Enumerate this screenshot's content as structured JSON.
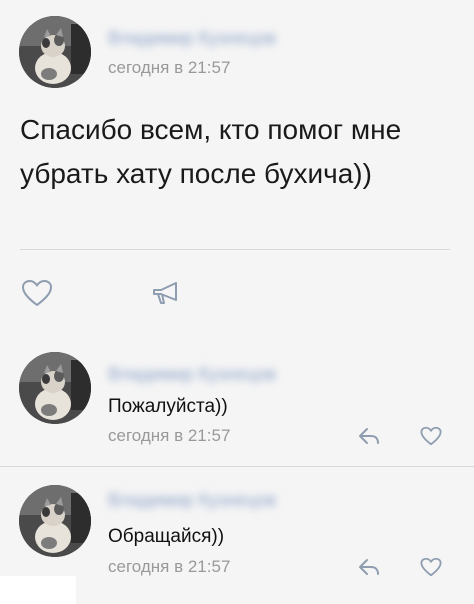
{
  "post": {
    "author_name": "Владимир Кузнецов",
    "timestamp": "сегодня в 21:57",
    "text": "Спасибо всем, кто помог мне убрать хату после бухича))",
    "actions": {
      "like_icon": "heart-icon",
      "share_icon": "megaphone-icon"
    }
  },
  "comments": [
    {
      "author_name": "Владимир Кузнецов",
      "text": "Пожалуйста))",
      "timestamp": "сегодня в 21:57",
      "reply_icon": "reply-icon",
      "like_icon": "heart-icon"
    },
    {
      "author_name": "Владимир Кузнецов",
      "text": "Обращайся))",
      "timestamp": "сегодня в 21:57",
      "reply_icon": "reply-icon",
      "like_icon": "heart-icon"
    }
  ],
  "colors": {
    "background": "#f5f5f5",
    "author_link": "#8ca3c9",
    "meta_text": "#999999",
    "icon": "#8f9db0",
    "divider": "#d9d9d9"
  }
}
